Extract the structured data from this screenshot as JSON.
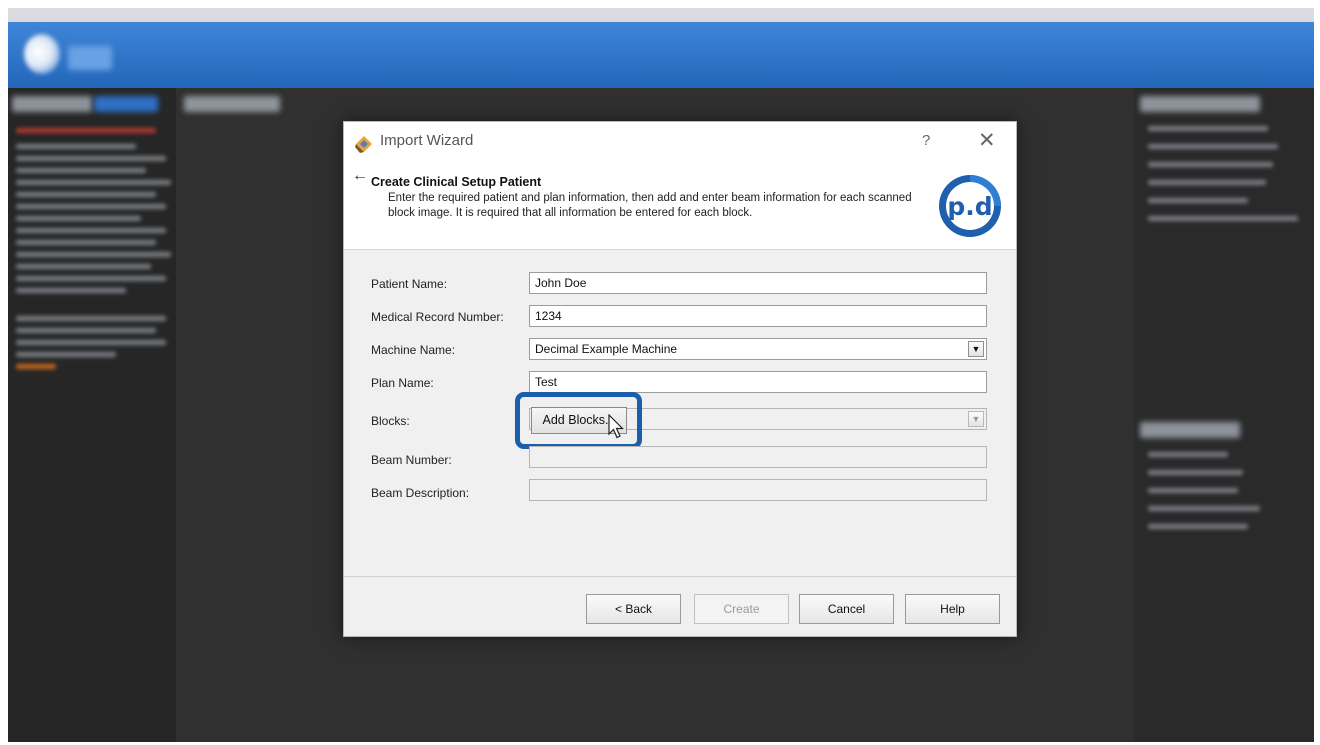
{
  "dialog": {
    "title": "Import Wizard",
    "help_glyph": "?",
    "close_glyph": "✕",
    "back_glyph": "←",
    "heading": "Create Clinical Setup Patient",
    "description": "Enter the required patient and plan information, then add and enter beam information for each scanned block image. It is required that all information be entered for each block.",
    "logo_text": "p.d"
  },
  "form": {
    "patient_name": {
      "label": "Patient Name:",
      "value": "John Doe"
    },
    "medical_record_number": {
      "label": "Medical Record Number:",
      "value": "1234"
    },
    "machine_name": {
      "label": "Machine Name:",
      "value": "Decimal Example Machine"
    },
    "plan_name": {
      "label": "Plan Name:",
      "value": "Test"
    },
    "blocks": {
      "label": "Blocks:",
      "button_label": "Add Blocks..."
    },
    "beam_number": {
      "label": "Beam Number:",
      "value": ""
    },
    "beam_description": {
      "label": "Beam Description:",
      "value": ""
    }
  },
  "buttons": {
    "back": "< Back",
    "create": "Create",
    "cancel": "Cancel",
    "help": "Help"
  },
  "icons": {
    "dropdown": "▼"
  },
  "colors": {
    "highlight": "#1b5fac",
    "header_blue": "#2f74c8"
  }
}
